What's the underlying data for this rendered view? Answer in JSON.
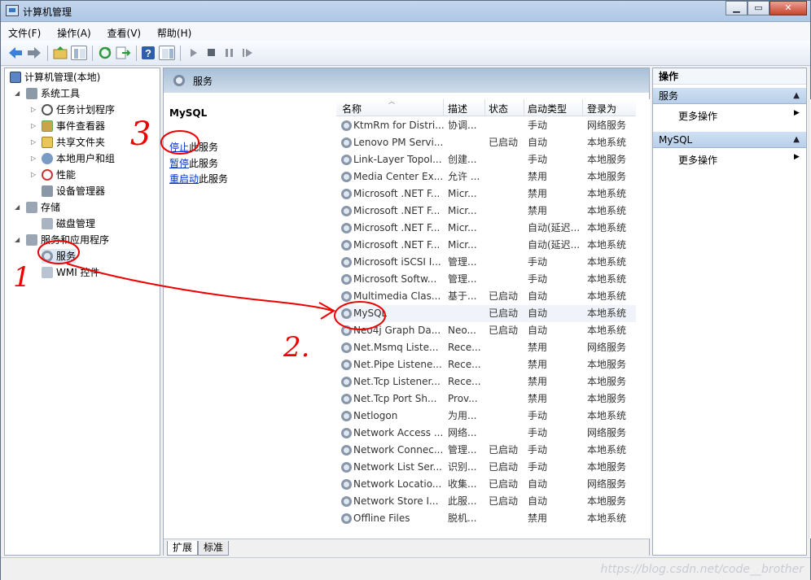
{
  "window": {
    "title": "计算机管理",
    "min": "▁",
    "max": "▭",
    "close": "✕"
  },
  "menu": [
    "文件(F)",
    "操作(A)",
    "查看(V)",
    "帮助(H)"
  ],
  "tree": {
    "root": "计算机管理(本地)",
    "system_tools": "系统工具",
    "task_scheduler": "任务计划程序",
    "event_viewer": "事件查看器",
    "shared_folders": "共享文件夹",
    "local_users": "本地用户和组",
    "performance": "性能",
    "device_manager": "设备管理器",
    "storage": "存储",
    "disk_management": "磁盘管理",
    "services_apps": "服务和应用程序",
    "services": "服务",
    "wmi": "WMI 控件"
  },
  "center": {
    "header": "服务",
    "selected_service": "MySQL",
    "actions": [
      {
        "link": "停止",
        "rest": "此服务"
      },
      {
        "link": "暂停",
        "rest": "此服务"
      },
      {
        "link": "重启动",
        "rest": "此服务"
      }
    ],
    "columns": [
      "名称",
      "描述",
      "状态",
      "启动类型",
      "登录为"
    ],
    "rows": [
      [
        "KtmRm for Distri...",
        "协调...",
        "",
        "手动",
        "网络服务"
      ],
      [
        "Lenovo PM Servi...",
        "",
        "已启动",
        "自动",
        "本地系统"
      ],
      [
        "Link-Layer Topol...",
        "创建...",
        "",
        "手动",
        "本地服务"
      ],
      [
        "Media Center Ex...",
        "允许 ...",
        "",
        "禁用",
        "本地服务"
      ],
      [
        "Microsoft .NET F...",
        "Micr...",
        "",
        "禁用",
        "本地系统"
      ],
      [
        "Microsoft .NET F...",
        "Micr...",
        "",
        "禁用",
        "本地系统"
      ],
      [
        "Microsoft .NET F...",
        "Micr...",
        "",
        "自动(延迟...",
        "本地系统"
      ],
      [
        "Microsoft .NET F...",
        "Micr...",
        "",
        "自动(延迟...",
        "本地系统"
      ],
      [
        "Microsoft iSCSI I...",
        "管理...",
        "",
        "手动",
        "本地系统"
      ],
      [
        "Microsoft Softw...",
        "管理...",
        "",
        "手动",
        "本地系统"
      ],
      [
        "Multimedia Clas...",
        "基于...",
        "已启动",
        "自动",
        "本地系统"
      ],
      [
        "MySQL",
        "",
        "已启动",
        "自动",
        "本地系统"
      ],
      [
        "Neo4j Graph Da...",
        "Neo...",
        "已启动",
        "自动",
        "本地系统"
      ],
      [
        "Net.Msmq Liste...",
        "Rece...",
        "",
        "禁用",
        "网络服务"
      ],
      [
        "Net.Pipe Listene...",
        "Rece...",
        "",
        "禁用",
        "本地服务"
      ],
      [
        "Net.Tcp Listener...",
        "Rece...",
        "",
        "禁用",
        "本地服务"
      ],
      [
        "Net.Tcp Port Sh...",
        "Prov...",
        "",
        "禁用",
        "本地服务"
      ],
      [
        "Netlogon",
        "为用...",
        "",
        "手动",
        "本地系统"
      ],
      [
        "Network Access ...",
        "网络...",
        "",
        "手动",
        "网络服务"
      ],
      [
        "Network Connec...",
        "管理...",
        "已启动",
        "手动",
        "本地系统"
      ],
      [
        "Network List Ser...",
        "识别...",
        "已启动",
        "手动",
        "本地服务"
      ],
      [
        "Network Locatio...",
        "收集...",
        "已启动",
        "自动",
        "网络服务"
      ],
      [
        "Network Store I...",
        "此服...",
        "已启动",
        "自动",
        "本地服务"
      ],
      [
        "Offline Files",
        "脱机...",
        "",
        "禁用",
        "本地系统"
      ]
    ],
    "tabs": [
      "扩展",
      "标准"
    ]
  },
  "actions": {
    "title": "操作",
    "section1": "服务",
    "section1_item": "更多操作",
    "section2": "MySQL",
    "section2_item": "更多操作"
  },
  "watermark": "https://blog.csdn.net/code__brother",
  "annotations": {
    "num1": "1",
    "num2": "2.",
    "num3": "3"
  }
}
